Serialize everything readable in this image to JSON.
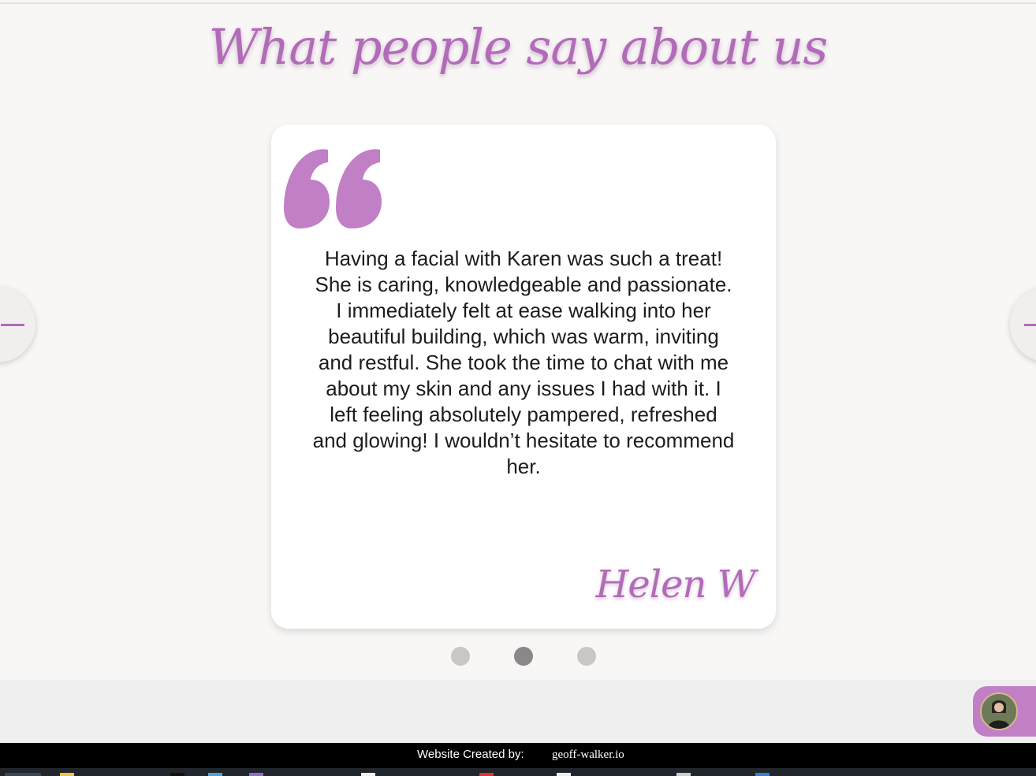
{
  "section": {
    "heading": "What people say about us"
  },
  "testimonial": {
    "text": "Having a facial with Karen was such a treat! She is caring, knowledgeable and passionate. I immediately felt at ease walking into her beautiful building, which was warm, inviting and restful. She took the time to chat with me about my skin and any issues I had with it. I left feeling absolutely pampered, refreshed and glowing! I wouldn’t hesitate to recommend her.",
    "author": "Helen W"
  },
  "carousel": {
    "slide_count": 3,
    "active_index": 2
  },
  "footer": {
    "label": "Website Created by:",
    "link": "geoff-walker.io"
  },
  "colors": {
    "accent": "#b26bb8",
    "background": "#f8f7f6",
    "card": "#ffffff",
    "dot": "#c9c7c6",
    "dot_active": "#8a8888",
    "footer": "#000000",
    "chat_widget": "#c17fc5"
  },
  "icons": {
    "quote": "opening-quote-icon",
    "prev": "arrow-left-icon",
    "next": "arrow-right-icon",
    "chat": "chat-avatar"
  }
}
